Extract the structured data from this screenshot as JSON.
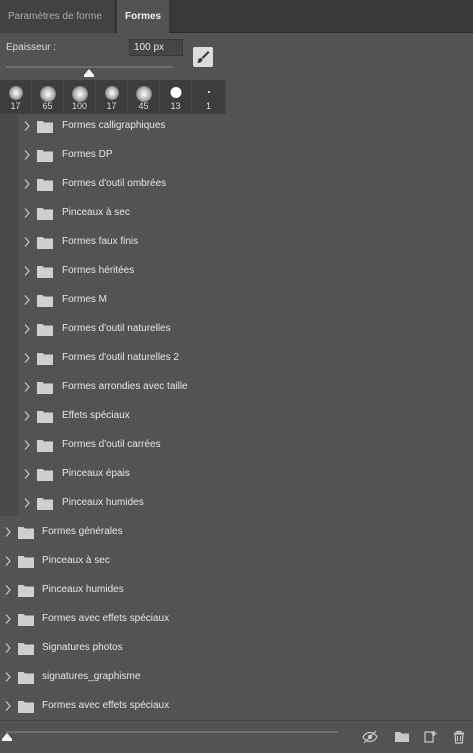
{
  "tabs": [
    {
      "label": "Paramètres de forme"
    },
    {
      "label": "Formes"
    }
  ],
  "size": {
    "label": "Epaisseur :",
    "value": "100 px",
    "slider_fraction": 0.5
  },
  "presets": [
    {
      "size": "17"
    },
    {
      "size": "65"
    },
    {
      "size": "100"
    },
    {
      "size": "17"
    },
    {
      "size": "45"
    },
    {
      "size": "13"
    },
    {
      "size": "1"
    }
  ],
  "nested_groups": [
    {
      "label": "Formes calligraphiques"
    },
    {
      "label": "Formes DP"
    },
    {
      "label": "Formes d'outil ombrées"
    },
    {
      "label": "Pinceaux à sec"
    },
    {
      "label": "Formes faux finis"
    },
    {
      "label": "Formes héritées"
    },
    {
      "label": "Formes M"
    },
    {
      "label": "Formes d'outil naturelles"
    },
    {
      "label": "Formes d'outil naturelles 2"
    },
    {
      "label": "Formes arrondies avec taille"
    },
    {
      "label": "Effets spéciaux"
    },
    {
      "label": "Formes d'outil carrées"
    },
    {
      "label": "Pinceaux épais"
    },
    {
      "label": "Pinceaux humides"
    }
  ],
  "top_groups": [
    {
      "label": "Formes générales"
    },
    {
      "label": "Pinceaux à sec"
    },
    {
      "label": "Pinceaux humides"
    },
    {
      "label": "Formes avec effets spéciaux"
    },
    {
      "label": "Signatures photos"
    },
    {
      "label": "signatures_graphisme"
    },
    {
      "label": "Formes avec effets spéciaux"
    }
  ],
  "bottom_icons": [
    "visibility-icon",
    "new-group-icon",
    "new-brush-icon",
    "delete-icon"
  ]
}
